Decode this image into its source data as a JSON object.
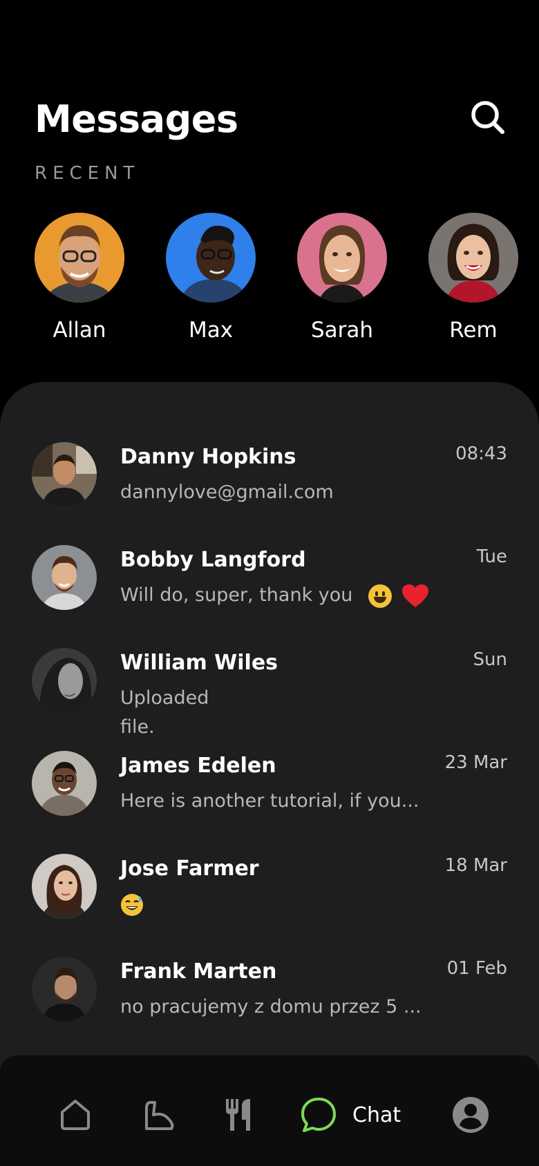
{
  "header": {
    "title": "Messages",
    "search_icon": "search-icon"
  },
  "recent": {
    "label": "RECENT",
    "contacts": [
      {
        "name": "Allan",
        "bg": "#e8932a"
      },
      {
        "name": "Max",
        "bg": "#2f7fe8"
      },
      {
        "name": "Sarah",
        "bg": "#d8728a"
      },
      {
        "name": "Rem",
        "bg": "#8a8a8a"
      }
    ]
  },
  "chats": [
    {
      "name": "Danny Hopkins",
      "preview": "dannylove@gmail.com",
      "time": "08:43"
    },
    {
      "name": "Bobby Langford",
      "preview": "Will do, super, thank you",
      "time": "Tue"
    },
    {
      "name": "William Wiles",
      "preview_line1": "Uploaded",
      "preview_line2": "file.",
      "time": "Sun"
    },
    {
      "name": "James Edelen",
      "preview": "Here is another tutorial, if you...",
      "time": "23 Mar"
    },
    {
      "name": "Jose Farmer",
      "preview": "",
      "time": "18 Mar"
    },
    {
      "name": "Frank Marten",
      "preview": "no pracujemy z domu przez 5 ...",
      "time": "01 Feb"
    }
  ],
  "nav": {
    "items": [
      "home-icon",
      "workout-icon",
      "food-icon",
      "chat-icon",
      "profile-icon"
    ],
    "active_label": "Chat",
    "active_color": "#7ed957"
  },
  "colors": {
    "background": "#000000",
    "panel": "#1e1e1e",
    "accent": "#7ed957"
  }
}
